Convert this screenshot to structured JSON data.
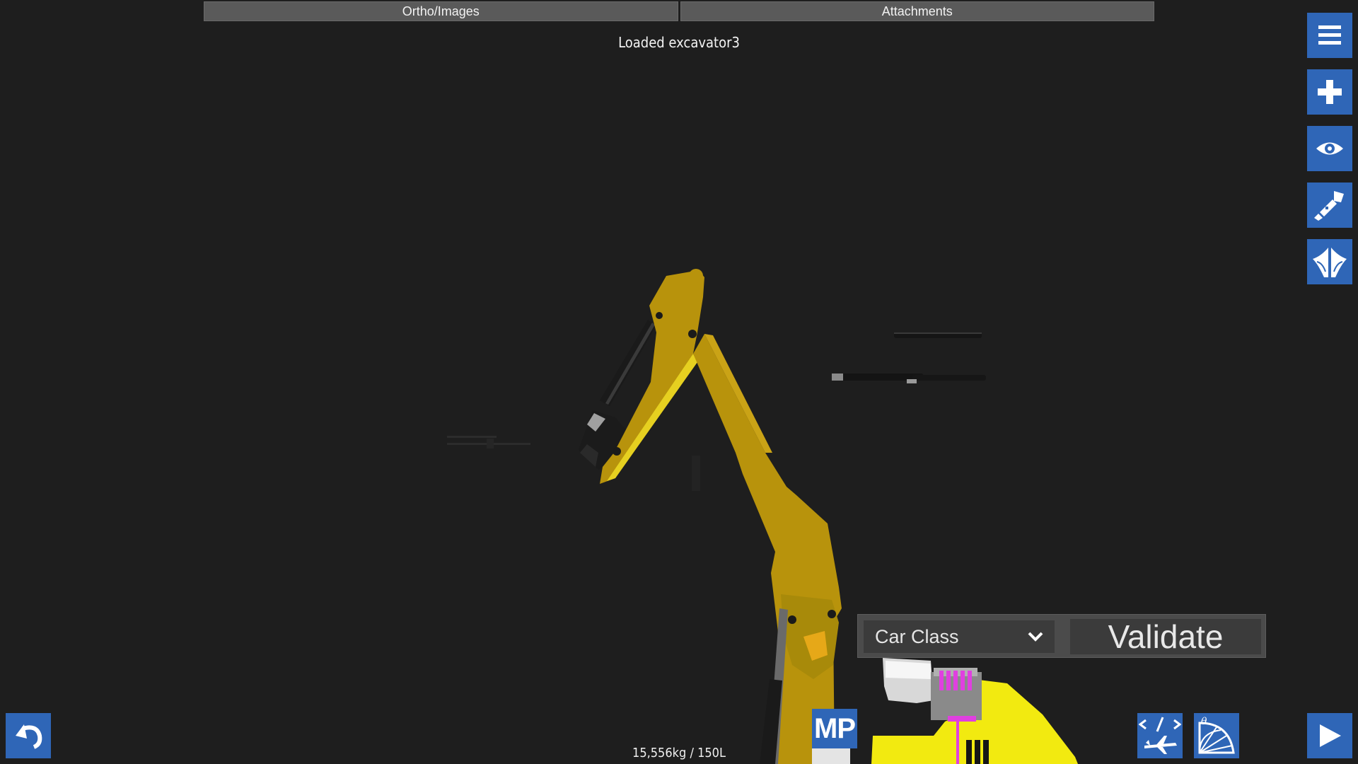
{
  "tabs": {
    "ortho_images": "Ortho/Images",
    "attachments": "Attachments"
  },
  "status_message": "Loaded excavator3",
  "sidebar": {
    "menu_icon": "hamburger-menu-icon",
    "add_icon": "plus-icon",
    "view_icon": "eye-icon",
    "paint_icon": "paint-brush-icon",
    "symmetry_icon": "symmetry-wings-icon"
  },
  "validation": {
    "class_selected": "Car Class",
    "validate_label": "Validate"
  },
  "footer": {
    "mass_fuel": "15,556kg / 150L",
    "mp_label": "MP"
  },
  "colors": {
    "button_blue": "#2f66b7",
    "background": "#1e1e1e",
    "arm_yellow": "#b8930c",
    "body_yellow": "#f2ea10",
    "pipe_magenta": "#e040e0"
  }
}
